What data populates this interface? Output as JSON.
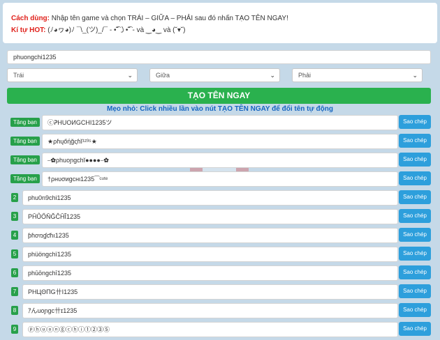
{
  "info": {
    "usage_label": "Cách dùng:",
    "usage_text": "Nhập tên game và chọn TRÁI – GIỮA – PHẢI sau đó nhấn TẠO TÊN NGAY!",
    "hot_label": "Kí tự HOT:",
    "hot_text": "(ﾉ◕ヮ◕)ﾉ ¯\\_(ツ)_/¯ - •͡˘㇁•͡˘ - và ‿◕‿ và (˘▾˘)"
  },
  "name_input": {
    "value": "phuongchi1235"
  },
  "selects": {
    "left": "Trái",
    "middle": "Giữa",
    "right": "Phải"
  },
  "generate_button": "TẠO TÊN NGAY",
  "tip": "Mẹo nhỏ: Click nhiều lần vào nút TẠO TÊN NGAY để đổi tên tự động",
  "copy_label": "Sao chép",
  "tag_label": "Tặng bạn",
  "featured": [
    "ⓒᕈHUOИGCHI1235ツ",
    "★ρɦųőήğςɦĭ¹²³⁵★",
    "⎯✿ρhuoɲgchĭ●●●●⎯✿",
    "†ρнυσиgcнι1235⁀ᶜᵘᵗᵉ"
  ],
  "generated": [
    {
      "num": "2",
      "text": "phu0n9chi1235"
    },
    {
      "num": "3",
      "text": "PĤŮŐŇĞĈĤĨ1235"
    },
    {
      "num": "4",
      "text": "ƥɦơռɠƈɦı1235"
    },
    {
      "num": "5",
      "text": "phüöngchï1235"
    },
    {
      "num": "6",
      "text": "phūōngchī1235"
    },
    {
      "num": "7",
      "text": "PHЦΘПG卄Ι1235"
    },
    {
      "num": "8",
      "text": "ｱんuoɲgc卄ɪ1235"
    },
    {
      "num": "9",
      "text": "ⓟⓗⓤⓞⓝⓖⓒⓗⓘ①②③⑤"
    }
  ],
  "colors": {
    "page_bg": "#c5d9e8",
    "button_green": "#2ab14e",
    "copy_blue": "#2d9fdc",
    "tip_blue": "#1565c0",
    "hot_red": "#e0201a"
  }
}
